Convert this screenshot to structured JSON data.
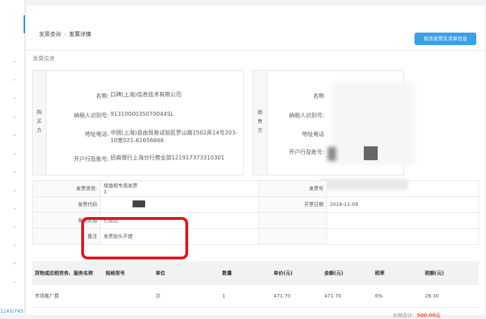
{
  "sidebar": {
    "pager_text": "1143/745"
  },
  "breadcrumb": {
    "parent": "发票查询",
    "separator": "›",
    "current": "发票详情"
  },
  "top_button": {
    "label": "修改发票及清单信息"
  },
  "section_title": "发票信息",
  "buyer": {
    "side_label": "购买方",
    "name_label": "名称:",
    "name": "口碑(上海)信息技术有限公司",
    "tax_label": "纳税人识别号:",
    "tax": "91310000350700445L",
    "addr_label": "地址电话:",
    "addr": "中国(上海)自由贸易试验区罗山路1502弄14号203-10室021-61656666",
    "bank_label": "开户行及账号:",
    "bank": "招商银行上海分行营业部121917373310301"
  },
  "seller": {
    "side_label": "销售方",
    "name_label": "名称",
    "tax_label": "纳税人识别号:",
    "addr_label": "地址电话",
    "bank_label": "开户行及账号:"
  },
  "invoice_info": {
    "type_label": "发票类型:",
    "type": "增值税专用发票",
    "type_suffix": "1",
    "code_label": "发票代码",
    "status_label": "发票状态",
    "status": "已驳回",
    "remark_label": "备注",
    "remark": "发票抬头开错",
    "number_label": "发票号",
    "date_label": "开票日期",
    "date": "2018-11-09"
  },
  "goods": {
    "headers": [
      "货物或应税劳务、服务名称",
      "规格型号",
      "单位",
      "数量",
      "单价(元)",
      "金额(元)",
      "税率",
      "税额(元)"
    ],
    "rows": [
      [
        "市场推广费",
        "",
        "次",
        "1",
        "471.70",
        "471.70",
        "6%",
        "28.30"
      ]
    ]
  },
  "total": {
    "label": "价税合计:",
    "value": "500.00元"
  }
}
